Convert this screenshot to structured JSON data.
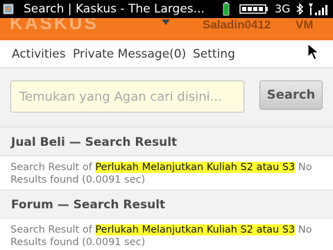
{
  "statusbar": {
    "title": "Search | Kaskus - The Larges...",
    "network": "3G",
    "icons": [
      "browser-app-icon",
      "battery-charging-icon",
      "battery-icon",
      "bluetooth-icon",
      "signal-bars-icon"
    ]
  },
  "header": {
    "logo": "KASKUS",
    "username": "Saladin0412",
    "vm_label": "VM"
  },
  "nav": {
    "items": [
      {
        "label": "Activities"
      },
      {
        "label": "Private Message(0)"
      },
      {
        "label": "Setting"
      }
    ]
  },
  "search": {
    "placeholder": "Temukan yang Agan cari disini...",
    "value": "",
    "button_label": "Search"
  },
  "sections": [
    {
      "title": "Jual Beli — Search Result",
      "result_prefix": "Search Result of",
      "query": "Perlukah Melanjutkan Kuliah S2 atau S3",
      "result_suffix": "No",
      "result_line2": "Results found (0.0091 sec)"
    },
    {
      "title": "Forum — Search Result",
      "result_prefix": "Search Result of",
      "query": "Perlukah Melanjutkan Kuliah S2 atau S3",
      "result_suffix": "No",
      "result_line2": "Results found (0.0091 sec)"
    }
  ],
  "colors": {
    "header_orange": "#f3781e",
    "highlight": "#ffff33",
    "input_bg": "#fffce0"
  }
}
